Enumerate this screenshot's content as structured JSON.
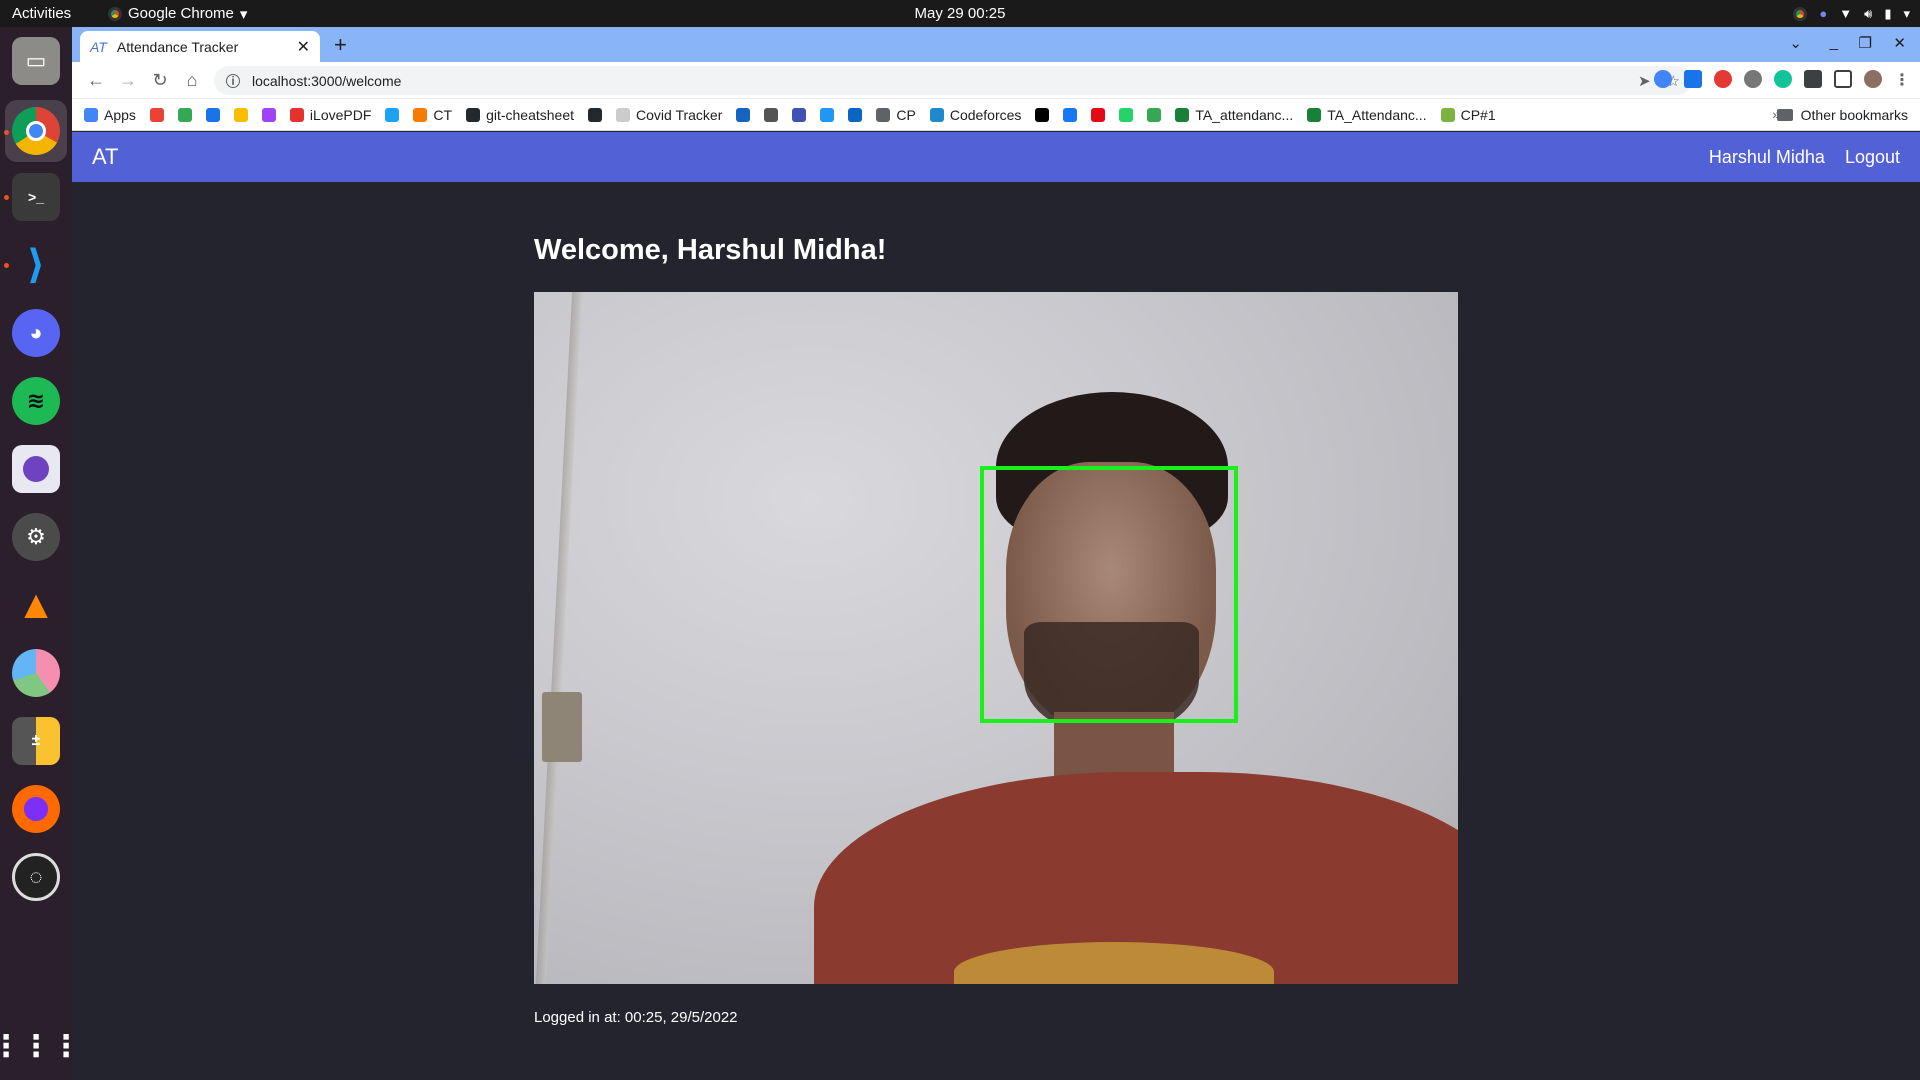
{
  "system": {
    "activities": "Activities",
    "app_menu": "Google Chrome",
    "clock": "May 29  00:25"
  },
  "browser": {
    "tab_title": "Attendance Tracker",
    "tab_favicon": "AT",
    "url": "localhost:3000/welcome",
    "bookmarks": [
      {
        "label": "Apps",
        "color": "#4285f4"
      },
      {
        "label": "",
        "color": "#ea4335"
      },
      {
        "label": "",
        "color": "#34a853"
      },
      {
        "label": "",
        "color": "#1a73e8"
      },
      {
        "label": "",
        "color": "#fbbc04"
      },
      {
        "label": "",
        "color": "#a142f4"
      },
      {
        "label": "iLovePDF",
        "color": "#e5322d"
      },
      {
        "label": "",
        "color": "#1da1f2"
      },
      {
        "label": "CT",
        "color": "#f57c00"
      },
      {
        "label": "git-cheatsheet",
        "color": "#24292e"
      },
      {
        "label": "",
        "color": "#24292e"
      },
      {
        "label": "Covid Tracker",
        "color": "#cccccc"
      },
      {
        "label": "",
        "color": "#1565c0"
      },
      {
        "label": "",
        "color": "#555555"
      },
      {
        "label": "",
        "color": "#3f51b5"
      },
      {
        "label": "",
        "color": "#2196f3"
      },
      {
        "label": "",
        "color": "#0a66c2"
      },
      {
        "label": "CP",
        "color": "#5f6368"
      },
      {
        "label": "Codeforces",
        "color": "#1f8acb"
      },
      {
        "label": "",
        "color": "#000000"
      },
      {
        "label": "",
        "color": "#1877f2"
      },
      {
        "label": "",
        "color": "#e50914"
      },
      {
        "label": "",
        "color": "#25d366"
      },
      {
        "label": "",
        "color": "#34a853"
      },
      {
        "label": "TA_attendanc...",
        "color": "#188038"
      },
      {
        "label": "TA_Attendanc...",
        "color": "#188038"
      },
      {
        "label": "CP#1",
        "color": "#7cb342"
      }
    ],
    "bookmarks_overflow": "»",
    "other_bookmarks": "Other bookmarks"
  },
  "app": {
    "brand": "AT",
    "user_name": "Harshul Midha",
    "logout": "Logout",
    "welcome": "Welcome, Harshul Midha!",
    "logged_in": "Logged in at: 00:25, 29/5/2022",
    "face_box_color": "#19f019"
  }
}
